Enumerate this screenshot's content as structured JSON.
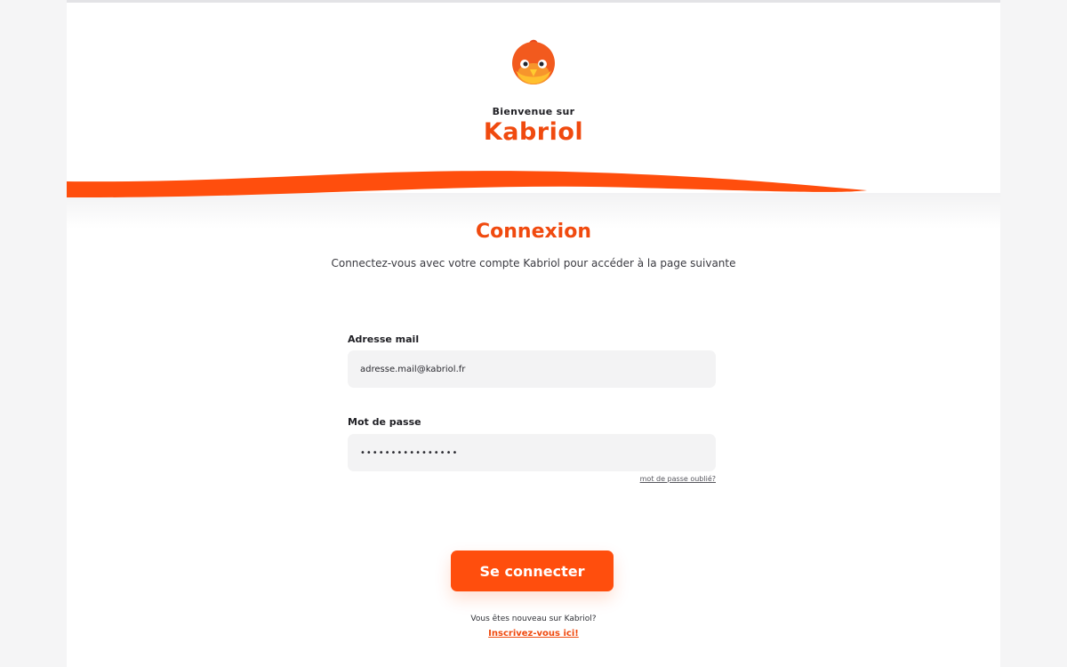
{
  "header": {
    "welcome": "Bienvenue sur",
    "brand": "Kabriol",
    "logo_icon": "kabriol-bird-logo"
  },
  "login": {
    "title": "Connexion",
    "subtitle": "Connectez-vous avec votre compte Kabriol pour accéder à la page suivante",
    "email_label": "Adresse mail",
    "email_value": "adresse.mail@kabriol.fr",
    "password_label": "Mot de passe",
    "password_value": "••••••••••••••••",
    "forgot_password": "mot de passe oublié?",
    "submit_label": "Se connecter",
    "new_user_text": "Vous êtes nouveau sur Kabriol?",
    "signup_link": "Inscrivez-vous ici!"
  },
  "colors": {
    "brand_orange": "#f04a0f",
    "button_orange": "#ff4e0d",
    "field_bg": "#f3f3f4"
  }
}
